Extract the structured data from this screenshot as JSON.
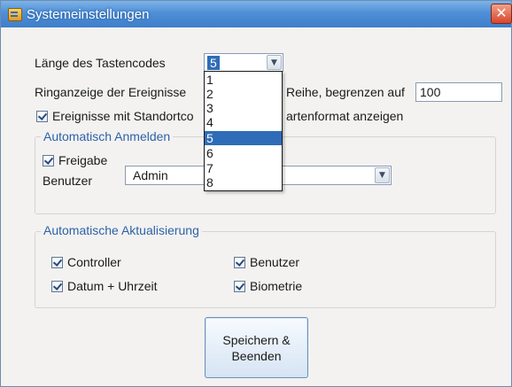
{
  "window": {
    "title": "Systemeinstellungen",
    "close_glyph": "✕"
  },
  "key_code": {
    "label": "Länge des Tastencodes",
    "selected": "5",
    "options": [
      "1",
      "2",
      "3",
      "4",
      "5",
      "6",
      "7",
      "8"
    ]
  },
  "ring": {
    "label_left": "Ringanzeige der Ereignisse",
    "label_right": "Reihe, begrenzen auf",
    "value": "100"
  },
  "standard": {
    "label_left": "Ereignisse mit Standortco",
    "label_right": "artenformat anzeigen",
    "checked": true
  },
  "auto_login": {
    "title": "Automatisch Anmelden",
    "share_label": "Freigabe",
    "share_checked": true,
    "user_label": "Benutzer",
    "user_value": "Admin"
  },
  "auto_update": {
    "title": "Automatische Aktualisierung",
    "items": [
      {
        "label": "Controller",
        "checked": true
      },
      {
        "label": "Benutzer",
        "checked": true
      },
      {
        "label": "Datum + Uhrzeit",
        "checked": true
      },
      {
        "label": "Biometrie",
        "checked": true
      }
    ]
  },
  "save_button": {
    "line1": "Speichern &",
    "line2": "Beenden"
  },
  "icons": {
    "app": "settings-window-icon",
    "dropdown_arrow": "chevron-down-icon",
    "close": "close-icon"
  },
  "colors": {
    "titlebar": "#4f8fd6",
    "selection": "#2f6cb8",
    "group_title": "#2d62a8",
    "close": "#d9452c"
  }
}
